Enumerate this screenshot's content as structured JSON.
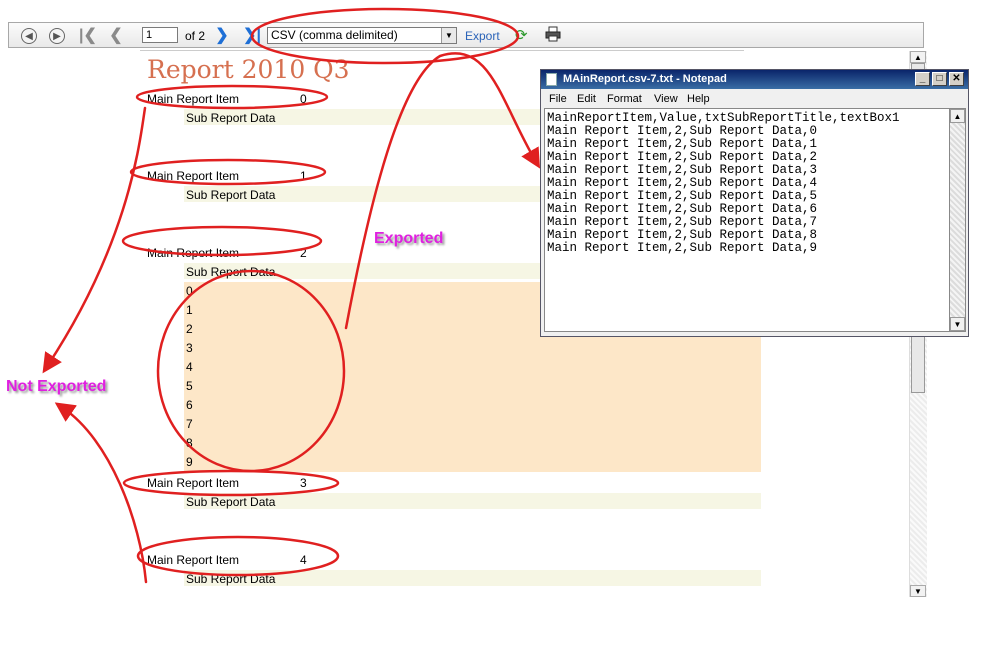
{
  "toolbar": {
    "page_value": "1",
    "page_of": "of 2",
    "export_format": "CSV (comma delimited)",
    "export_label": "Export"
  },
  "report": {
    "title": "Report 2010 Q3",
    "main_items": [
      {
        "label": "Main Report Item",
        "value": "0",
        "sub": "Sub Report Data"
      },
      {
        "label": "Main Report Item",
        "value": "1",
        "sub": "Sub Report Data"
      },
      {
        "label": "Main Report Item",
        "value": "2",
        "sub": "Sub Report Data"
      },
      {
        "label": "Main Report Item",
        "value": "3",
        "sub": "Sub Report Data"
      },
      {
        "label": "Main Report Item",
        "value": "4",
        "sub": "Sub Report Data"
      }
    ],
    "detail_numbers": [
      "0",
      "1",
      "2",
      "3",
      "4",
      "5",
      "6",
      "7",
      "8",
      "9"
    ]
  },
  "notepad": {
    "title": "MAinReport.csv-7.txt - Notepad",
    "menu": [
      "File",
      "Edit",
      "Format",
      "View",
      "Help"
    ],
    "lines": [
      "MainReportItem,Value,txtSubReportTitle,textBox1",
      "Main Report Item,2,Sub Report Data,0",
      "Main Report Item,2,Sub Report Data,1",
      "Main Report Item,2,Sub Report Data,2",
      "Main Report Item,2,Sub Report Data,3",
      "Main Report Item,2,Sub Report Data,4",
      "Main Report Item,2,Sub Report Data,5",
      "Main Report Item,2,Sub Report Data,6",
      "Main Report Item,2,Sub Report Data,7",
      "Main Report Item,2,Sub Report Data,8",
      "Main Report Item,2,Sub Report Data,9"
    ]
  },
  "annotations": {
    "exported": "Exported",
    "not_exported": "Not Exported",
    "color": "#e020e0",
    "marker_color": "#e02020"
  }
}
